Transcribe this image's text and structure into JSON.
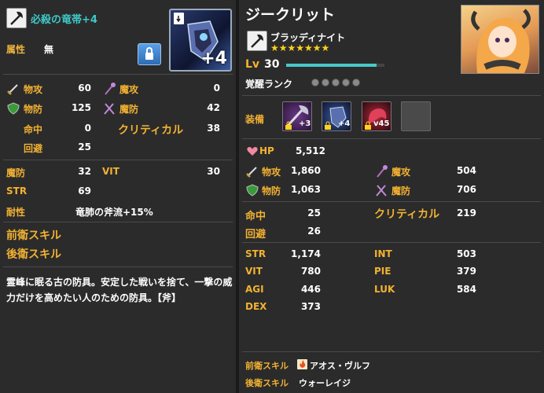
{
  "item": {
    "name": "必殺の竜帯+4",
    "attribute_label": "属性",
    "attribute_value": "無",
    "plus_badge": "+4",
    "stats_main": [
      {
        "label": "物攻",
        "value": "60",
        "icon": "sword-icon"
      },
      {
        "label": "物防",
        "value": "125",
        "icon": "shield-icon"
      },
      {
        "label": "命中",
        "value": "0"
      },
      {
        "label": "回避",
        "value": "25"
      }
    ],
    "stats_side": [
      {
        "label": "魔攻",
        "value": "0",
        "icon": "staff-icon"
      },
      {
        "label": "魔防",
        "value": "42",
        "icon": "crossed-staves-icon"
      },
      {
        "label": "クリティカル",
        "value": "38"
      }
    ],
    "stats_extra": [
      {
        "label": "魔防",
        "value": "32"
      },
      {
        "label": "VIT",
        "value": "30"
      },
      {
        "label": "STR",
        "value": "69"
      }
    ],
    "trait_label": "耐性",
    "trait_value": "竜肺の斧流+15%",
    "front_skill_label": "前衛スキル",
    "back_skill_label": "後衛スキル",
    "description": "霊峰に眠る古の防具。安定した戦いを捨て、一撃の威力だけを高めたい人のための防具。【斧】"
  },
  "character": {
    "name": "ジークリット",
    "class": "ブラッディナイト",
    "stars": "★★★★★★★",
    "level_label": "Lv",
    "level": "30",
    "level_progress": 0.92,
    "awaken_label": "覚醒ランク",
    "equip_label": "装備",
    "equip_slots": [
      {
        "name": "axe-weapon",
        "badge": "+3"
      },
      {
        "name": "armor",
        "badge": "+4"
      },
      {
        "name": "dragon-accessory",
        "badge": "v45"
      },
      {
        "name": "empty-slot",
        "badge": ""
      }
    ],
    "hp_label": "HP",
    "hp": "5,512",
    "patk_label": "物攻",
    "patk": "1,860",
    "matk_label": "魔攻",
    "matk": "504",
    "pdef_label": "物防",
    "pdef": "1,063",
    "mdef_label": "魔防",
    "mdef": "706",
    "hit_label": "命中",
    "hit": "25",
    "crit_label": "クリティカル",
    "crit": "219",
    "eva_label": "回避",
    "eva": "26",
    "str_label": "STR",
    "str": "1,174",
    "int_label": "INT",
    "int": "503",
    "vit_label": "VIT",
    "vit": "780",
    "pie_label": "PIE",
    "pie": "379",
    "agi_label": "AGI",
    "agi": "446",
    "luk_label": "LUK",
    "luk": "584",
    "dex_label": "DEX",
    "dex": "373",
    "front_skill_label": "前衛スキル",
    "front_skill_value": "アオス・ヴルフ",
    "back_skill_label": "後衛スキル",
    "back_skill_value": "ウォーレイジ"
  },
  "colors": {
    "gold": "#f0b43c",
    "teal": "#3ec8c8",
    "hpbar": "#48c8c8"
  }
}
